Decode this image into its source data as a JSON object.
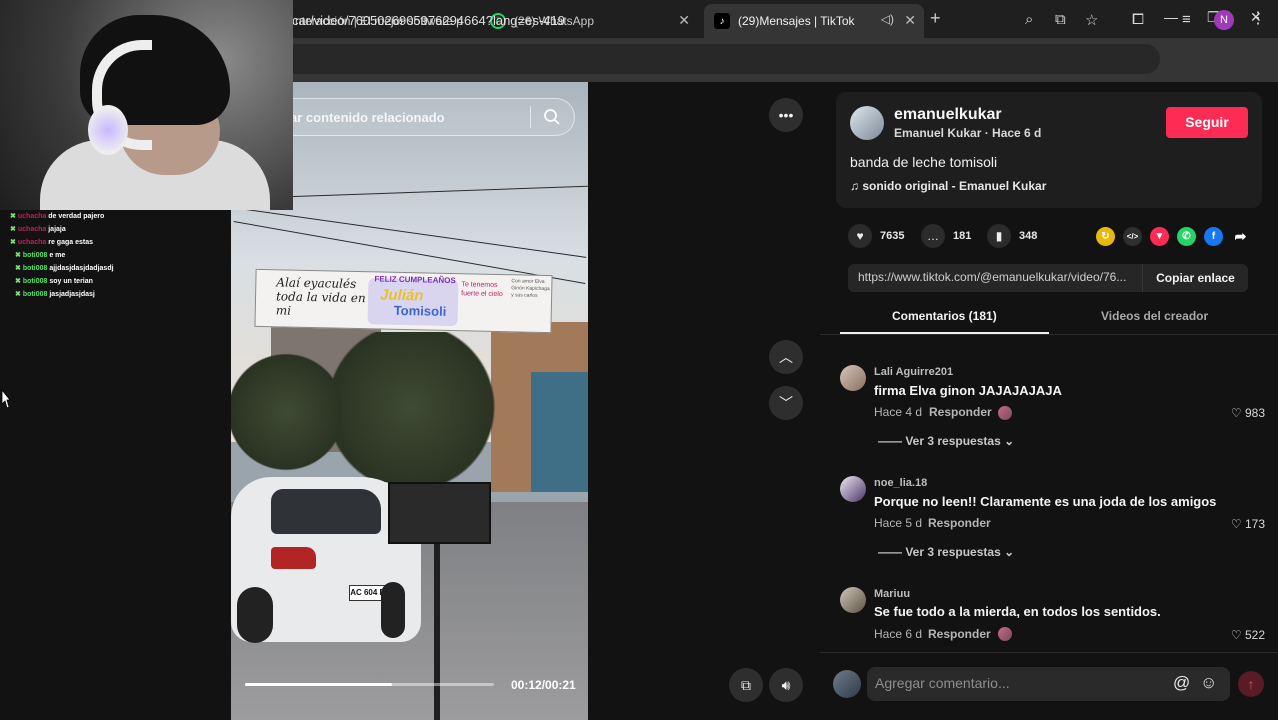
{
  "browser": {
    "tabs": [
      {
        "title": "nteracción | El mejor software p"
      },
      {
        "title": "(26) WhatsApp"
      },
      {
        "title": "(29)Mensajes | TikTok"
      }
    ],
    "url": "car/video/7605026905976294664?lang=es-419",
    "profile_initial": "N"
  },
  "chat_overlay": {
    "lines": [
      {
        "user": "uchacha",
        "text": "de verdad pajero"
      },
      {
        "user": "uchacha",
        "text": "jajaja"
      },
      {
        "user": "uchacha",
        "text": "re gaga estas"
      },
      {
        "user": "boti008",
        "text": "e me"
      },
      {
        "user": "boti008",
        "text": "ajjdasjdasjdadjasdj"
      },
      {
        "user": "boti008",
        "text": "soy un terian"
      },
      {
        "user": "boti008",
        "text": "jasjadjasjdasj"
      }
    ]
  },
  "video": {
    "search_placeholder": "ar contenido relacionado",
    "current_time": "00:12/00:21",
    "progress": 0.59,
    "banner": {
      "left_text": "Alaí eyaculés toda la vida en mi",
      "feliz": "FELIZ CUMPLEAÑOS",
      "name1": "Julián",
      "name2": "Tomisoli",
      "right_text": "Te tenemos fuerte el cielo",
      "far_text": "Con amor Elva Ginón Kapichaga y sus carlos"
    },
    "plate": "AC 604 BJ"
  },
  "creator": {
    "username": "emanuelkukar",
    "subtitle": "Emanuel Kukar · Hace 6 d",
    "follow_label": "Seguir",
    "description": "banda de leche tomisoli",
    "sound": "sonido original - Emanuel Kukar"
  },
  "stats": {
    "likes": "7635",
    "comments": "181",
    "saves": "348"
  },
  "share": {
    "link": "https://www.tiktok.com/@emanuelkukar/video/76...",
    "copy_label": "Copiar enlace"
  },
  "tabs": {
    "comments": "Comentarios (181)",
    "creator_videos": "Videos del creador"
  },
  "comments": [
    {
      "user": "Lali Aguirre201",
      "text": "firma Elva ginon JAJAJAJAJA",
      "time": "Hace 4 d",
      "reply": "Responder",
      "likes": "983",
      "more": "Ver 3 respuestas"
    },
    {
      "user": "noe_lia.18",
      "text": "Porque no leen!! Claramente es una joda de los amigos",
      "time": "Hace 5 d",
      "reply": "Responder",
      "likes": "173",
      "more": "Ver 3 respuestas"
    },
    {
      "user": "Mariuu",
      "text": "Se fue todo a la mierda, en todos los sentidos.",
      "time": "Hace 6 d",
      "reply": "Responder",
      "likes": "522"
    }
  ],
  "composer": {
    "placeholder": "Agregar comentario..."
  },
  "colors": {
    "accent": "#fe2c55",
    "background": "#121212"
  }
}
